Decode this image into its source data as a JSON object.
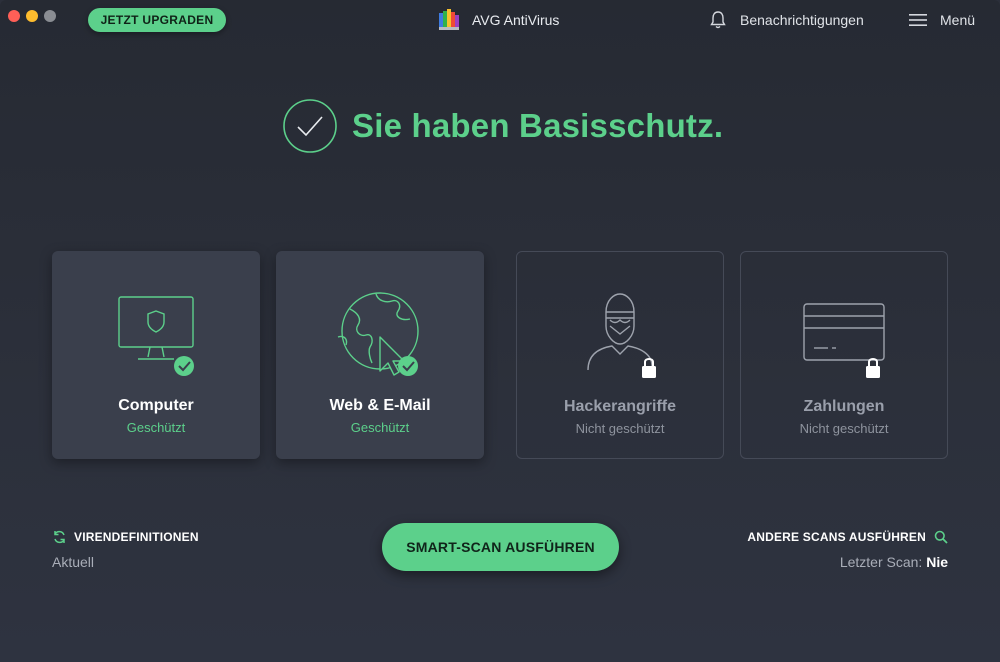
{
  "titlebar": {
    "upgrade_label": "JETZT UPGRADEN",
    "app_title": "AVG AntiVirus",
    "notifications_label": "Benachrichtigungen",
    "menu_label": "Menü"
  },
  "status": {
    "headline": "Sie haben Basisschutz."
  },
  "cards": [
    {
      "title": "Computer",
      "status": "Geschützt",
      "protected": true,
      "icon": "monitor-shield-icon"
    },
    {
      "title": "Web & E-Mail",
      "status": "Geschützt",
      "protected": true,
      "icon": "globe-cursor-icon"
    },
    {
      "title": "Hackerangriffe",
      "status": "Nicht geschützt",
      "protected": false,
      "icon": "hacker-icon"
    },
    {
      "title": "Zahlungen",
      "status": "Nicht geschützt",
      "protected": false,
      "icon": "credit-card-icon"
    }
  ],
  "footer": {
    "virus_definitions_label": "VIRENDEFINITIONEN",
    "virus_definitions_value": "Aktuell",
    "smart_scan_label": "SMART-SCAN AUSFÜHREN",
    "other_scans_label": "ANDERE SCANS AUSFÜHREN",
    "last_scan_label": "Letzter Scan:",
    "last_scan_value": "Nie"
  },
  "colors": {
    "accent": "#5cd08b",
    "background": "#2b2f3a",
    "card_active": "#3a3f4c"
  }
}
